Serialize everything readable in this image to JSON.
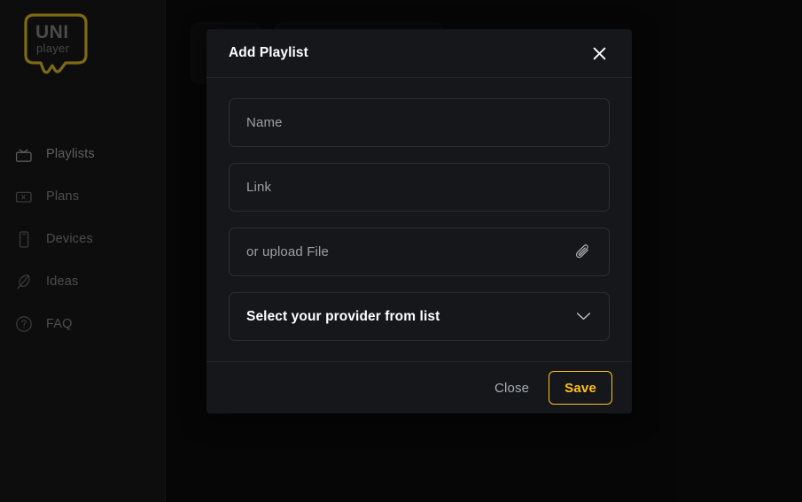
{
  "app": {
    "logo": {
      "line1": "UNI",
      "line2": "player",
      "icon": "speech-bubble-logo",
      "color": "#7d6a14"
    }
  },
  "sidebar": {
    "items": [
      {
        "label": "Playlists",
        "icon": "tv-icon",
        "active": true
      },
      {
        "label": "Plans",
        "icon": "card-icon",
        "active": false
      },
      {
        "label": "Devices",
        "icon": "phone-icon",
        "active": false
      },
      {
        "label": "Ideas",
        "icon": "feather-icon",
        "active": false
      },
      {
        "label": "FAQ",
        "icon": "question-circle-icon",
        "active": false
      }
    ]
  },
  "modal": {
    "title": "Add Playlist",
    "close_icon": "close-icon",
    "fields": {
      "name": {
        "placeholder": "Name",
        "value": ""
      },
      "link": {
        "placeholder": "Link",
        "value": ""
      },
      "file": {
        "placeholder": "or upload File",
        "value": "",
        "icon": "paperclip-icon"
      }
    },
    "provider_select": {
      "label": "Select your provider from list",
      "icon": "chevron-down-icon"
    },
    "footer": {
      "close_label": "Close",
      "save_label": "Save"
    }
  },
  "colors": {
    "accent": "#ffc01e",
    "logo_outline": "#7d6a14",
    "modal_bg": "#16171a",
    "page_bg": "#0a0a0a",
    "sidebar_bg": "#0d0d0d",
    "placeholder": "#9aa0a6"
  }
}
